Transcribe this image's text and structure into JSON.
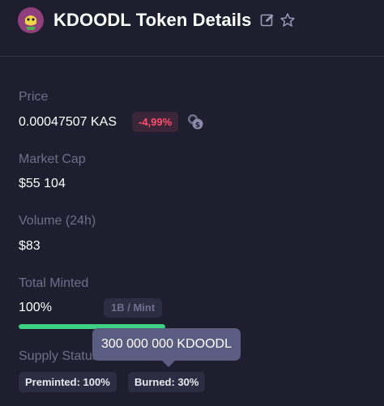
{
  "header": {
    "title": "KDOODL Token Details",
    "icons": [
      "token-avatar",
      "edit-icon",
      "star-icon"
    ]
  },
  "price": {
    "label": "Price",
    "value": "0.00047507 KAS",
    "change": "-4,99%",
    "change_color": "#ff4d6d"
  },
  "market_cap": {
    "label": "Market Cap",
    "value": "$55 104"
  },
  "volume": {
    "label": "Volume (24h)",
    "value": "$83"
  },
  "minted": {
    "label": "Total Minted",
    "value": "100%",
    "per_mint": "1B / Mint",
    "progress_percent": 100,
    "progress_color": "#3fd184"
  },
  "supply": {
    "label": "Supply Status",
    "preminted": "Preminted: 100%",
    "burned": "Burned: 30%"
  },
  "tooltip": {
    "text": "300 000 000 KDOODL"
  }
}
